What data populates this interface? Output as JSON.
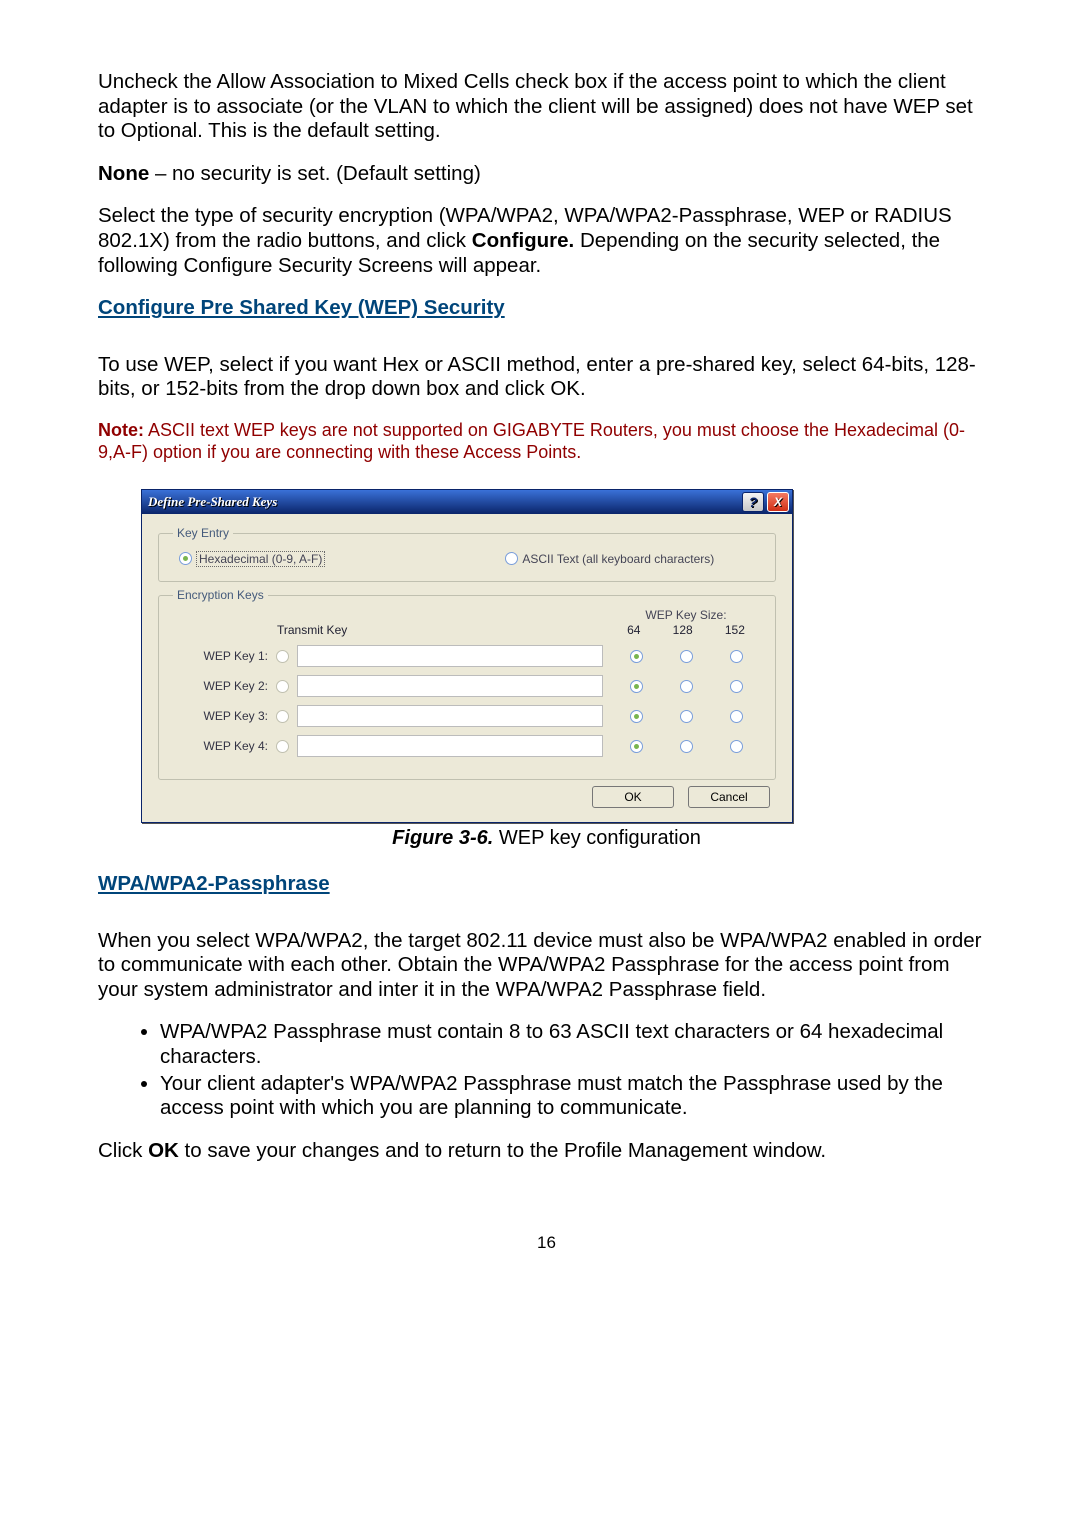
{
  "para1": "Uncheck the Allow Association to Mixed Cells check box if the access point to which the client adapter is to associate (or the VLAN to which the client will be assigned) does not have WEP set to Optional. This is the default setting.",
  "none_label": "None",
  "none_text": " – no security is set. (Default setting)",
  "para2_a": "Select the type of security encryption (WPA/WPA2, WPA/WPA2-Passphrase, WEP or RADIUS 802.1X) from the radio buttons, and click ",
  "para2_bold": "Configure.",
  "para2_b": " Depending on the security selected, the following Configure Security Screens will appear.",
  "section1": "Configure Pre Shared Key (WEP) Security",
  "para3": "To use WEP, select if you want Hex or ASCII method, enter a pre-shared key, select 64-bits, 128-bits, or 152-bits from the drop down box and click OK.",
  "note_label": "Note:",
  "note_text": " ASCII text WEP keys are not supported on GIGABYTE Routers, you must choose the Hexadecimal (0-9,A-F) option if you are connecting with these Access Points.",
  "dialog": {
    "title": "Define Pre-Shared Keys",
    "help_glyph": "?",
    "close_glyph": "X",
    "key_entry_legend": "Key Entry",
    "hex_label": "Hexadecimal (0-9, A-F)",
    "ascii_label": "ASCII Text (all keyboard characters)",
    "enc_legend": "Encryption Keys",
    "transmit_label": "Transmit Key",
    "size_label": "WEP Key Size:",
    "size_cols": [
      "64",
      "128",
      "152"
    ],
    "rows": [
      "WEP Key 1:",
      "WEP Key 2:",
      "WEP Key 3:",
      "WEP Key 4:"
    ],
    "ok": "OK",
    "cancel": "Cancel"
  },
  "fig_num": "Figure 3-6.",
  "fig_text": "    WEP key configuration",
  "section2": "WPA/WPA2-Passphrase  ",
  "para4": "When you select WPA/WPA2, the target 802.11 device must also be WPA/WPA2 enabled in order to communicate with each other. Obtain the WPA/WPA2 Passphrase for the access point from your system administrator and inter it in the WPA/WPA2 Passphrase field.",
  "bul1": "WPA/WPA2 Passphrase must contain 8 to 63 ASCII text characters or 64 hexadecimal characters.",
  "bul2": "Your client adapter's WPA/WPA2 Passphrase must match the Passphrase used by the access point with which you are planning to communicate.",
  "para5_a": "Click ",
  "para5_bold": "OK",
  "para5_b": " to save your changes and to return to the Profile Management window.",
  "page_number": "16"
}
